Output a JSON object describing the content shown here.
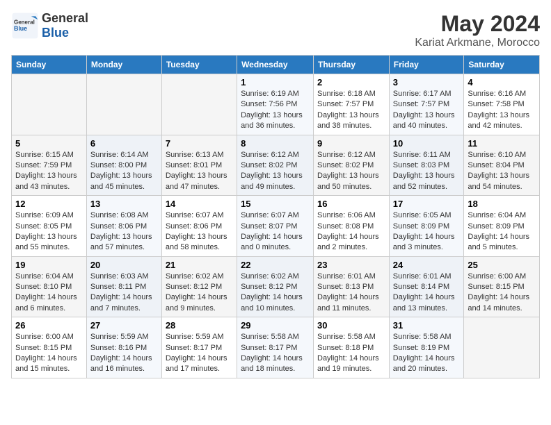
{
  "header": {
    "logo_general": "General",
    "logo_blue": "Blue",
    "main_title": "May 2024",
    "subtitle": "Kariat Arkmane, Morocco"
  },
  "days_of_week": [
    "Sunday",
    "Monday",
    "Tuesday",
    "Wednesday",
    "Thursday",
    "Friday",
    "Saturday"
  ],
  "weeks": [
    [
      {
        "day": "",
        "info": ""
      },
      {
        "day": "",
        "info": ""
      },
      {
        "day": "",
        "info": ""
      },
      {
        "day": "1",
        "sunrise": "Sunrise: 6:19 AM",
        "sunset": "Sunset: 7:56 PM",
        "daylight": "Daylight: 13 hours and 36 minutes."
      },
      {
        "day": "2",
        "sunrise": "Sunrise: 6:18 AM",
        "sunset": "Sunset: 7:57 PM",
        "daylight": "Daylight: 13 hours and 38 minutes."
      },
      {
        "day": "3",
        "sunrise": "Sunrise: 6:17 AM",
        "sunset": "Sunset: 7:57 PM",
        "daylight": "Daylight: 13 hours and 40 minutes."
      },
      {
        "day": "4",
        "sunrise": "Sunrise: 6:16 AM",
        "sunset": "Sunset: 7:58 PM",
        "daylight": "Daylight: 13 hours and 42 minutes."
      }
    ],
    [
      {
        "day": "5",
        "sunrise": "Sunrise: 6:15 AM",
        "sunset": "Sunset: 7:59 PM",
        "daylight": "Daylight: 13 hours and 43 minutes."
      },
      {
        "day": "6",
        "sunrise": "Sunrise: 6:14 AM",
        "sunset": "Sunset: 8:00 PM",
        "daylight": "Daylight: 13 hours and 45 minutes."
      },
      {
        "day": "7",
        "sunrise": "Sunrise: 6:13 AM",
        "sunset": "Sunset: 8:01 PM",
        "daylight": "Daylight: 13 hours and 47 minutes."
      },
      {
        "day": "8",
        "sunrise": "Sunrise: 6:12 AM",
        "sunset": "Sunset: 8:02 PM",
        "daylight": "Daylight: 13 hours and 49 minutes."
      },
      {
        "day": "9",
        "sunrise": "Sunrise: 6:12 AM",
        "sunset": "Sunset: 8:02 PM",
        "daylight": "Daylight: 13 hours and 50 minutes."
      },
      {
        "day": "10",
        "sunrise": "Sunrise: 6:11 AM",
        "sunset": "Sunset: 8:03 PM",
        "daylight": "Daylight: 13 hours and 52 minutes."
      },
      {
        "day": "11",
        "sunrise": "Sunrise: 6:10 AM",
        "sunset": "Sunset: 8:04 PM",
        "daylight": "Daylight: 13 hours and 54 minutes."
      }
    ],
    [
      {
        "day": "12",
        "sunrise": "Sunrise: 6:09 AM",
        "sunset": "Sunset: 8:05 PM",
        "daylight": "Daylight: 13 hours and 55 minutes."
      },
      {
        "day": "13",
        "sunrise": "Sunrise: 6:08 AM",
        "sunset": "Sunset: 8:06 PM",
        "daylight": "Daylight: 13 hours and 57 minutes."
      },
      {
        "day": "14",
        "sunrise": "Sunrise: 6:07 AM",
        "sunset": "Sunset: 8:06 PM",
        "daylight": "Daylight: 13 hours and 58 minutes."
      },
      {
        "day": "15",
        "sunrise": "Sunrise: 6:07 AM",
        "sunset": "Sunset: 8:07 PM",
        "daylight": "Daylight: 14 hours and 0 minutes."
      },
      {
        "day": "16",
        "sunrise": "Sunrise: 6:06 AM",
        "sunset": "Sunset: 8:08 PM",
        "daylight": "Daylight: 14 hours and 2 minutes."
      },
      {
        "day": "17",
        "sunrise": "Sunrise: 6:05 AM",
        "sunset": "Sunset: 8:09 PM",
        "daylight": "Daylight: 14 hours and 3 minutes."
      },
      {
        "day": "18",
        "sunrise": "Sunrise: 6:04 AM",
        "sunset": "Sunset: 8:09 PM",
        "daylight": "Daylight: 14 hours and 5 minutes."
      }
    ],
    [
      {
        "day": "19",
        "sunrise": "Sunrise: 6:04 AM",
        "sunset": "Sunset: 8:10 PM",
        "daylight": "Daylight: 14 hours and 6 minutes."
      },
      {
        "day": "20",
        "sunrise": "Sunrise: 6:03 AM",
        "sunset": "Sunset: 8:11 PM",
        "daylight": "Daylight: 14 hours and 7 minutes."
      },
      {
        "day": "21",
        "sunrise": "Sunrise: 6:02 AM",
        "sunset": "Sunset: 8:12 PM",
        "daylight": "Daylight: 14 hours and 9 minutes."
      },
      {
        "day": "22",
        "sunrise": "Sunrise: 6:02 AM",
        "sunset": "Sunset: 8:12 PM",
        "daylight": "Daylight: 14 hours and 10 minutes."
      },
      {
        "day": "23",
        "sunrise": "Sunrise: 6:01 AM",
        "sunset": "Sunset: 8:13 PM",
        "daylight": "Daylight: 14 hours and 11 minutes."
      },
      {
        "day": "24",
        "sunrise": "Sunrise: 6:01 AM",
        "sunset": "Sunset: 8:14 PM",
        "daylight": "Daylight: 14 hours and 13 minutes."
      },
      {
        "day": "25",
        "sunrise": "Sunrise: 6:00 AM",
        "sunset": "Sunset: 8:15 PM",
        "daylight": "Daylight: 14 hours and 14 minutes."
      }
    ],
    [
      {
        "day": "26",
        "sunrise": "Sunrise: 6:00 AM",
        "sunset": "Sunset: 8:15 PM",
        "daylight": "Daylight: 14 hours and 15 minutes."
      },
      {
        "day": "27",
        "sunrise": "Sunrise: 5:59 AM",
        "sunset": "Sunset: 8:16 PM",
        "daylight": "Daylight: 14 hours and 16 minutes."
      },
      {
        "day": "28",
        "sunrise": "Sunrise: 5:59 AM",
        "sunset": "Sunset: 8:17 PM",
        "daylight": "Daylight: 14 hours and 17 minutes."
      },
      {
        "day": "29",
        "sunrise": "Sunrise: 5:58 AM",
        "sunset": "Sunset: 8:17 PM",
        "daylight": "Daylight: 14 hours and 18 minutes."
      },
      {
        "day": "30",
        "sunrise": "Sunrise: 5:58 AM",
        "sunset": "Sunset: 8:18 PM",
        "daylight": "Daylight: 14 hours and 19 minutes."
      },
      {
        "day": "31",
        "sunrise": "Sunrise: 5:58 AM",
        "sunset": "Sunset: 8:19 PM",
        "daylight": "Daylight: 14 hours and 20 minutes."
      },
      {
        "day": "",
        "info": ""
      }
    ]
  ]
}
